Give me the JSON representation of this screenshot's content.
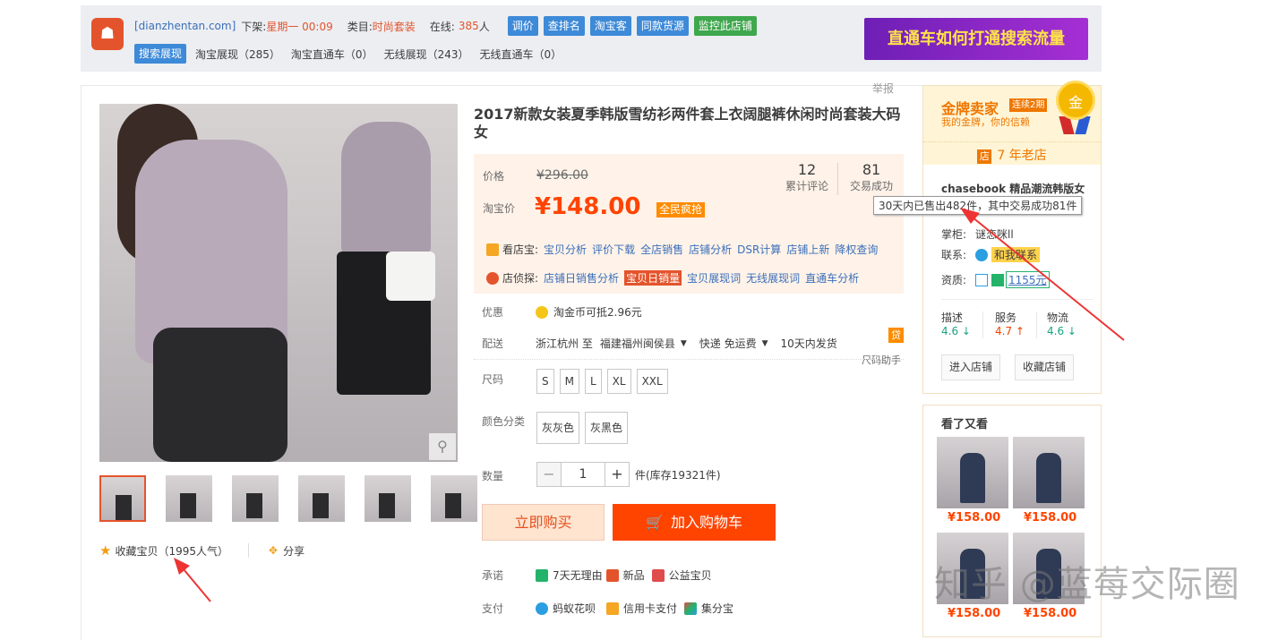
{
  "topbar": {
    "site": "[dianzhentan.com]",
    "offshelf_label": "下架:",
    "offshelf_value": "星期一 00:09",
    "category_label": "类目:",
    "category_value": "时尚套装",
    "online_label": "在线:",
    "online_value": "385",
    "online_unit": "人",
    "buttons": [
      "调价",
      "查排名",
      "淘宝客",
      "同款货源",
      "监控此店铺"
    ],
    "search_btn": "搜索展现",
    "stats": [
      "淘宝展现（285）",
      "淘宝直通车（0）",
      "无线展现（243）",
      "无线直通车（0）"
    ],
    "banner_text": "直通车如何打通搜索流量"
  },
  "report": "举报",
  "product": {
    "title": "2017新款女装夏季韩版雪纺衫两件套上衣阔腿裤休闲时尚套装大码女",
    "price_label": "价格",
    "price_old": "¥296.00",
    "reviews_count": "12",
    "reviews_label": "累计评论",
    "deals_count": "81",
    "deals_label": "交易成功",
    "taobao_price_label": "淘宝价",
    "price_now": "¥148.00",
    "price_tag": "全民疯抢",
    "tool1_label": "看店宝:",
    "tool1_links": [
      "宝贝分析",
      "评价下载",
      "全店销售",
      "店铺分析",
      "DSR计算",
      "店铺上新",
      "降权查询"
    ],
    "tool2_label": "店侦探:",
    "tool2_links": [
      "店铺日销售分析",
      "宝贝日销量",
      "宝贝展现词",
      "无线展现词",
      "直通车分析"
    ],
    "promo_label": "优惠",
    "promo_text": "淘金币可抵2.96元",
    "ship_label": "配送",
    "ship_from": "浙江杭州 至",
    "ship_to": "福建福州闽侯县",
    "ship_method": "快递 免运费",
    "ship_time": "10天内发货",
    "ship_badge": "贷",
    "size_help": "尺码助手",
    "size_label": "尺码",
    "sizes": [
      "S",
      "M",
      "L",
      "XL",
      "XXL"
    ],
    "color_label": "颜色分类",
    "colors": [
      "灰灰色",
      "灰黑色"
    ],
    "qty_label": "数量",
    "qty_value": "1",
    "qty_minus": "−",
    "qty_plus": "+",
    "stock_text": "件(库存19321件)",
    "buy_label": "立即购买",
    "cart_label": "加入购物车",
    "promise_label": "承诺",
    "promises": [
      "7天无理由",
      "新品",
      "公益宝贝"
    ],
    "pay_label": "支付",
    "pays": [
      "蚂蚁花呗",
      "信用卡支付",
      "集分宝"
    ]
  },
  "gallery": {
    "fav_text": "收藏宝贝（1995人气）",
    "share_text": "分享"
  },
  "seller": {
    "gold_title": "金牌卖家",
    "gold_tag": "连续2期",
    "gold_sub": "我的金牌，你的信赖",
    "medal": "金",
    "age_badge": "店",
    "age_text": "7 年老店",
    "shop_name": "chasebook 精品潮流韩版女",
    "tooltip": "30天内已售出482件，其中交易成功81件",
    "keeper_label": "掌柜:",
    "keeper_value": "谜恋咪ll",
    "contact_label": "联系:",
    "contact_value": "和我联系",
    "qual_label": "资质:",
    "qual_value": "1155元",
    "rates": [
      {
        "label": "描述",
        "value": "4.6 ↓"
      },
      {
        "label": "服务",
        "value": "4.7 ↑"
      },
      {
        "label": "物流",
        "value": "4.6 ↓"
      }
    ],
    "enter_btn": "进入店铺",
    "fav_btn": "收藏店铺"
  },
  "also": {
    "title": "看了又看",
    "prices": [
      "¥158.00",
      "¥158.00",
      "¥158.00",
      "¥158.00"
    ]
  },
  "watermark": "知乎 @蓝莓交际圈",
  "colors": {
    "accent": "#ff4400",
    "gold": "#ee7700",
    "link": "#3a6fba"
  }
}
